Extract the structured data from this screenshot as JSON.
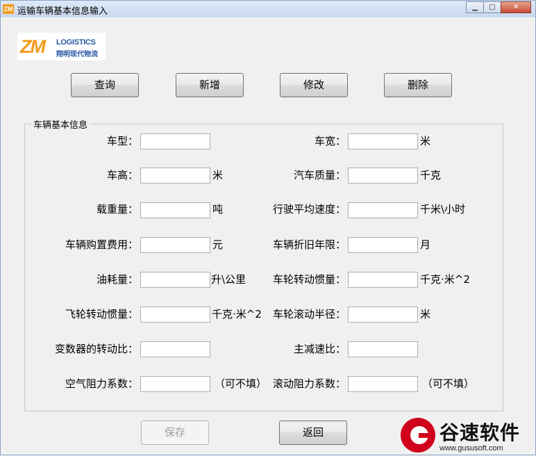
{
  "window": {
    "title": "运输车辆基本信息输入",
    "app_icon": "ZM",
    "minimize_glyph": "▁",
    "maximize_glyph": "□",
    "close_glyph": "✕"
  },
  "logo": {
    "mark": "ZM",
    "english": "LOGISTICS",
    "chinese": "翔明现代物流"
  },
  "toolbar": {
    "query": "查询",
    "add": "新增",
    "modify": "修改",
    "delete": "删除"
  },
  "group": {
    "title": "车辆基本信息",
    "fields": [
      {
        "label": "车型：",
        "value": "",
        "unit": ""
      },
      {
        "label": "车宽：",
        "value": "",
        "unit": "米"
      },
      {
        "label": "车高：",
        "value": "",
        "unit": "米"
      },
      {
        "label": "汽车质量：",
        "value": "",
        "unit": "千克"
      },
      {
        "label": "载重量：",
        "value": "",
        "unit": "吨"
      },
      {
        "label": "行驶平均速度：",
        "value": "",
        "unit": "千米\\小时"
      },
      {
        "label": "车辆购置费用：",
        "value": "",
        "unit": "元"
      },
      {
        "label": "车辆折旧年限：",
        "value": "",
        "unit": "月"
      },
      {
        "label": "油耗量：",
        "value": "",
        "unit": "升\\公里"
      },
      {
        "label": "车轮转动惯量：",
        "value": "",
        "unit": "千克·米^2"
      },
      {
        "label": "飞轮转动惯量：",
        "value": "",
        "unit": "千克·米^2"
      },
      {
        "label": "车轮滚动半径：",
        "value": "",
        "unit": "米"
      },
      {
        "label": "变数器的转动比：",
        "value": "",
        "unit": ""
      },
      {
        "label": "主减速比：",
        "value": "",
        "unit": ""
      },
      {
        "label": "空气阻力系数：",
        "value": "",
        "unit": "（可不填）"
      },
      {
        "label": "滚动阻力系数：",
        "value": "",
        "unit": "（可不填）"
      }
    ]
  },
  "footer": {
    "save": "保存",
    "back": "返回"
  },
  "watermark": {
    "text": "谷速软件",
    "url": "www.gususoft.com"
  }
}
